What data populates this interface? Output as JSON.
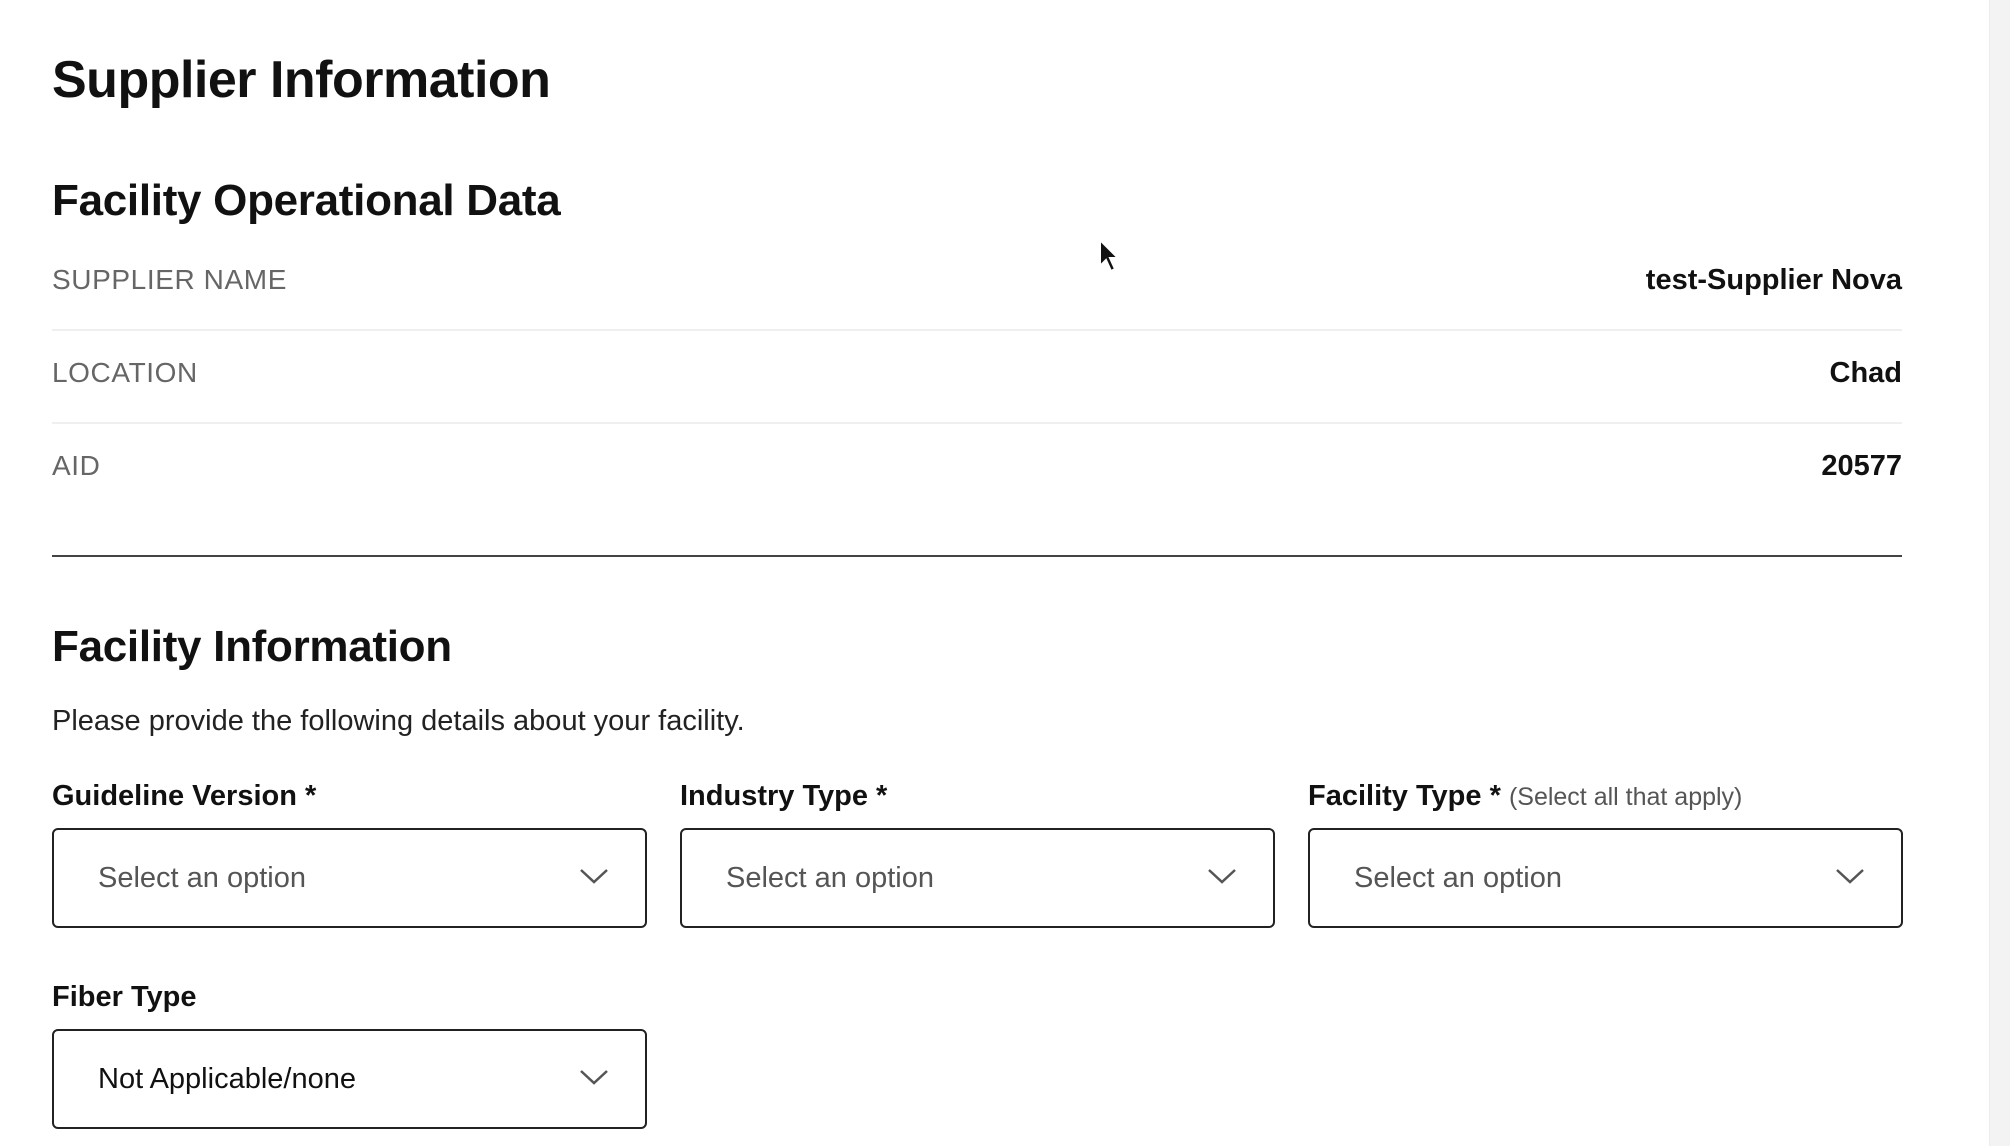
{
  "page": {
    "title": "Supplier Information"
  },
  "operational": {
    "title": "Facility Operational Data",
    "rows": [
      {
        "label": "SUPPLIER NAME",
        "value": "test-Supplier Nova"
      },
      {
        "label": "LOCATION",
        "value": "Chad"
      },
      {
        "label": "AID",
        "value": "20577"
      }
    ]
  },
  "facility": {
    "title": "Facility Information",
    "helper": "Please provide the following details about your facility.",
    "fields": [
      {
        "label": "Guideline Version *",
        "hint": "",
        "value": "Select an option"
      },
      {
        "label": "Industry Type *",
        "hint": "",
        "value": "Select an option"
      },
      {
        "label": "Facility Type *",
        "hint": "(Select all that apply)",
        "value": "Select an option"
      },
      {
        "label": "Fiber Type",
        "hint": "",
        "value": "Not Applicable/none"
      }
    ]
  },
  "icons": {
    "dropdown": "chevron-down-icon",
    "pointer": "mouse-cursor-icon"
  }
}
